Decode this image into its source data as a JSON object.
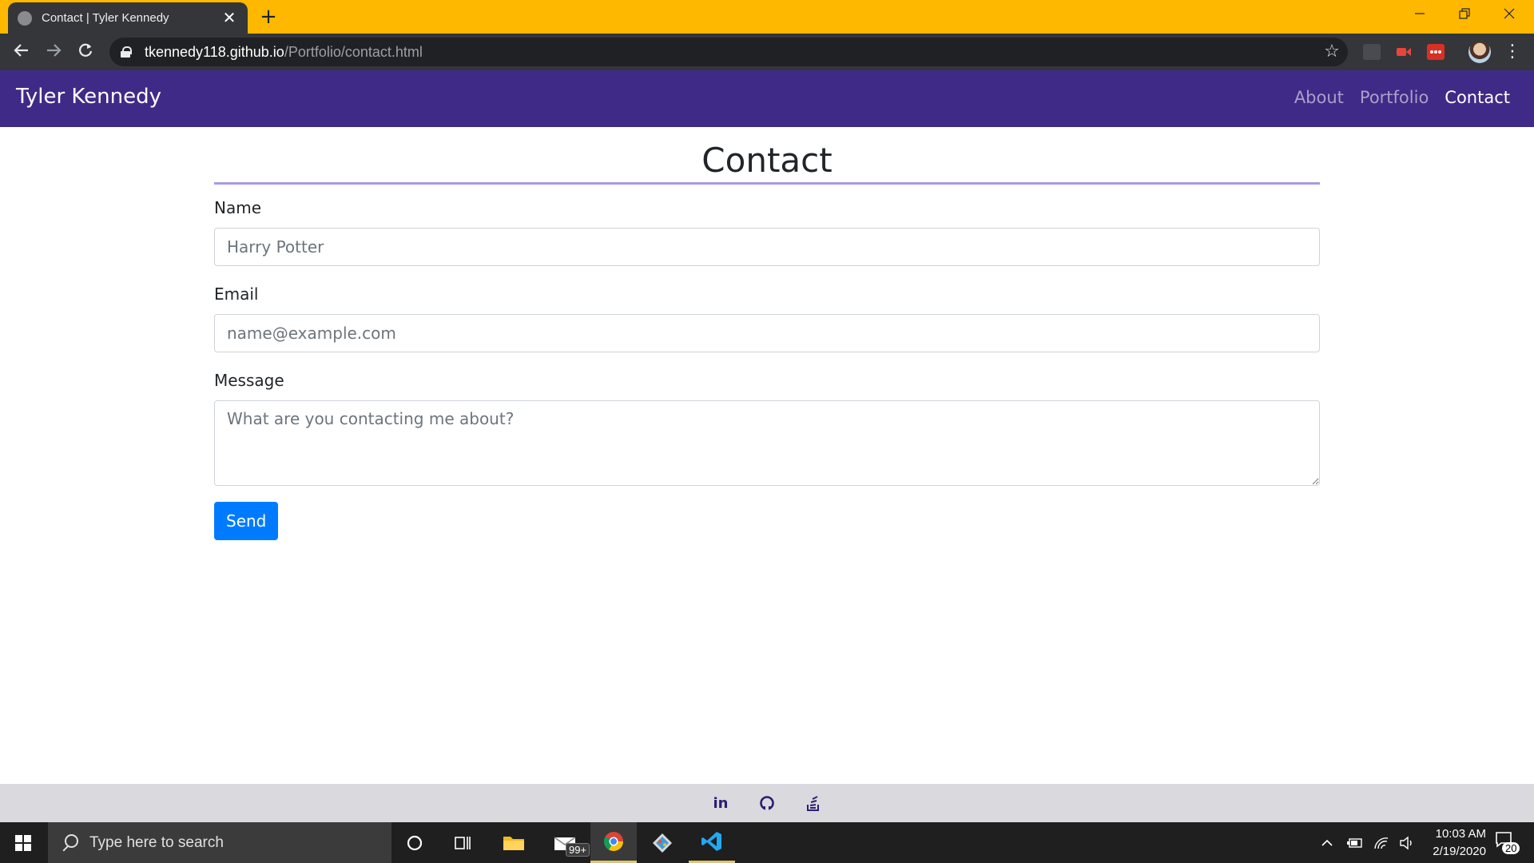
{
  "browser": {
    "tab_title": "Contact | Tyler Kennedy",
    "tab_close": "✕",
    "new_tab": "+",
    "url_host": "tkennedy118.github.io",
    "url_path": "/Portfolio/contact.html",
    "frame_color": "#ffb800"
  },
  "site": {
    "brand": "Tyler Kennedy",
    "nav": [
      {
        "label": "About",
        "active": false
      },
      {
        "label": "Portfolio",
        "active": false
      },
      {
        "label": "Contact",
        "active": true
      }
    ],
    "nav_color": "#402a87"
  },
  "form": {
    "title": "Contact",
    "name_label": "Name",
    "name_placeholder": "Harry Potter",
    "email_label": "Email",
    "email_placeholder": "name@example.com",
    "message_label": "Message",
    "message_placeholder": "What are you contacting me about?",
    "send_label": "Send",
    "accent_color": "#007bff"
  },
  "footer": {
    "icons": [
      "linkedin-icon",
      "github-icon",
      "stack-overflow-icon"
    ],
    "linkedin_text": "in"
  },
  "taskbar": {
    "search_placeholder": "Type here to search",
    "mail_badge": "99+",
    "time": "10:03 AM",
    "date": "2/19/2020",
    "notification_count": "20"
  }
}
